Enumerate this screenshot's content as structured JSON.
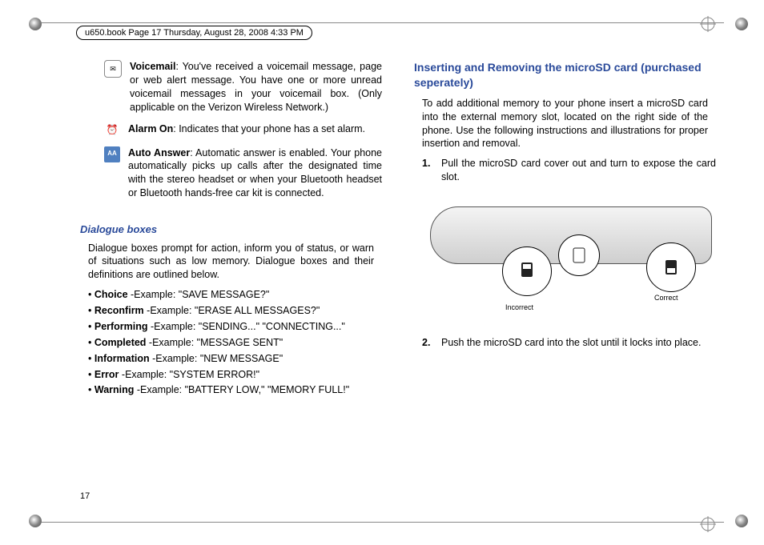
{
  "meta": {
    "header_line": "u650.book  Page 17  Thursday, August 28, 2008  4:33 PM",
    "page_number": "17"
  },
  "left": {
    "voicemail_label": "Voicemail",
    "voicemail_text": ": You've received a voicemail message, page or web alert message. You have one or more unread voicemail messages in your voicemail box. (Only applicable on the Verizon Wireless Network.)",
    "alarm_label": "Alarm On",
    "alarm_text": ": Indicates that your phone has a set alarm.",
    "autoanswer_label": "Auto Answer",
    "autoanswer_text": ": Automatic answer is enabled. Your phone automatically picks up calls after the designated time with the stereo headset or when your Bluetooth headset or Bluetooth hands-free car kit is connected.",
    "dialogue_heading": "Dialogue boxes",
    "dialogue_intro": "Dialogue boxes prompt for action, inform you of status, or warn of situations such as low memory. Dialogue boxes and their definitions are outlined below.",
    "bullets": {
      "choice_b": "Choice",
      "choice_t": " -Example: \"SAVE MESSAGE?\"",
      "reconfirm_b": "Reconfirm",
      "reconfirm_t": " -Example: \"ERASE ALL MESSAGES?\"",
      "performing_b": "Performing",
      "performing_t": " -Example: \"SENDING...\" \"CONNECTING...\"",
      "completed_b": "Completed",
      "completed_t": " -Example: \"MESSAGE SENT\"",
      "information_b": "Information",
      "information_t": " -Example: \"NEW MESSAGE\"",
      "error_b": "Error",
      "error_t": " -Example: \"SYSTEM ERROR!\"",
      "warning_b": "Warning",
      "warning_t": " -Example: \"BATTERY LOW,\" \"MEMORY FULL!\""
    }
  },
  "right": {
    "heading": "Inserting and Removing the microSD card (purchased seperately)",
    "intro": "To add additional memory to your phone insert a microSD card into the external memory slot, located on the right side of the phone. Use the following instructions and illustrations for proper insertion and removal.",
    "step1_num": "1.",
    "step1_text": "Pull the microSD card cover out and turn to expose the card slot.",
    "fig_incorrect": "Incorrect",
    "fig_correct": "Correct",
    "step2_num": "2.",
    "step2_text": "Push the microSD card into the slot until it locks into place."
  },
  "icons": {
    "voicemail_glyph": "✉",
    "alarm_glyph": "⏰",
    "aa_glyph": "AA"
  }
}
